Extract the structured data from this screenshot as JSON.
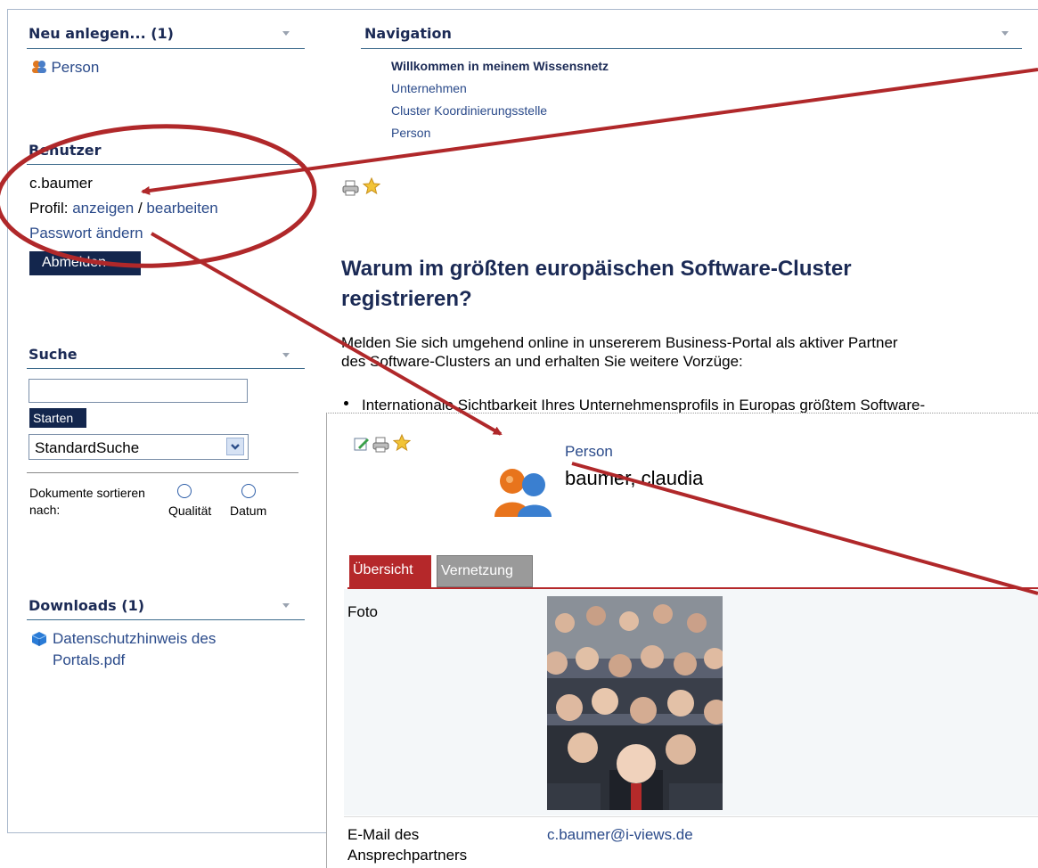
{
  "left": {
    "new_box": {
      "title": "Neu anlegen... (1)",
      "item": "Person"
    },
    "user_box": {
      "title": "Benutzer",
      "username": "c.baumer",
      "profile_label": "Profil:",
      "view_link": "anzeigen",
      "separator": "/",
      "edit_link": "bearbeiten",
      "password_link": "Passwort ändern",
      "logout_button": "Abmelden"
    },
    "search_box": {
      "title": "Suche",
      "input_value": "",
      "start_button": "Starten",
      "select_value": "StandardSuche",
      "sort_label_1": "Dokumente sortieren",
      "sort_label_2": "nach:",
      "option_quality": "Qualität",
      "option_date": "Datum"
    },
    "downloads_box": {
      "title": "Downloads (1)",
      "item_line1": "Datenschutzhinweis des",
      "item_line2": "Portals.pdf"
    }
  },
  "navigation": {
    "title": "Navigation",
    "items": [
      "Willkommen in meinem Wissensnetz",
      "Unternehmen",
      "Cluster Koordinierungsstelle",
      "Person"
    ]
  },
  "main": {
    "heading_line1": "Warum im größten europäischen Software-Cluster",
    "heading_line2": "registrieren?",
    "para_line1": "Melden Sie sich umgehend online in unsererem Business-Portal als aktiver Partner",
    "para_line2": "des Software-Clusters an und erhalten Sie weitere Vorzüge:",
    "bullet": "Internationale Sichtbarkeit Ihres Unternehmensprofils in Europas größtem Software-"
  },
  "profile": {
    "type_label": "Person",
    "name": "baumer, claudia",
    "tabs": [
      "Übersicht",
      "Vernetzung"
    ],
    "photo_label": "Foto",
    "email_label_1": "E-Mail des",
    "email_label_2": "Ansprechpartners",
    "email_value": "c.baumer@i-views.de"
  },
  "colors": {
    "accent": "#1b2a55",
    "annotation": "#b0282a",
    "tab_active": "#b5282a",
    "tab_inactive": "#9a9a9a"
  }
}
